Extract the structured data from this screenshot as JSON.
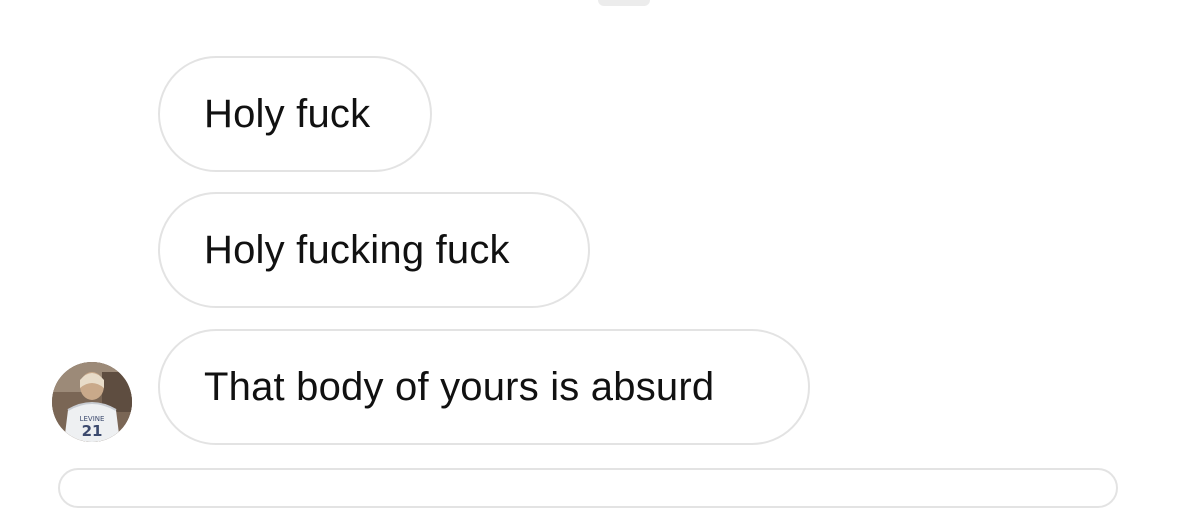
{
  "conversation": {
    "messages": [
      {
        "text": "Holy fuck"
      },
      {
        "text": "Holy fucking fuck"
      },
      {
        "text": "That body of yours is absurd"
      }
    ]
  },
  "sender_avatar": {
    "jersey_name": "LEVINE",
    "jersey_number": "21"
  },
  "colors": {
    "background": "#ffffff",
    "bubble_border": "#e3e3e3",
    "text": "#111111"
  }
}
